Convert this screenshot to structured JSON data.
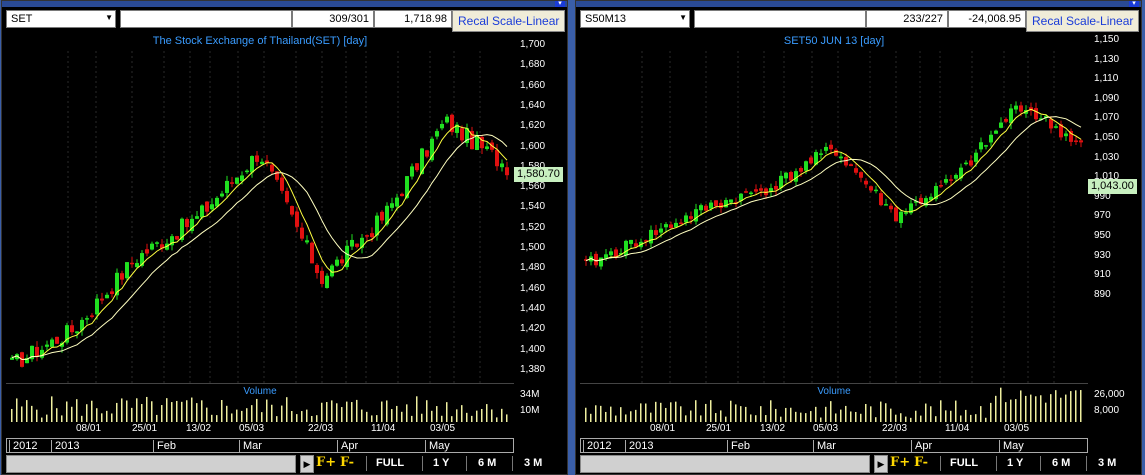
{
  "panels": [
    {
      "symbol": "SET",
      "ratio": "309/301",
      "last_value": "1,718.98",
      "recal_label": "Recal Scale-Linear",
      "chart_title": "The Stock Exchange of Thailand(SET) [day]",
      "volume_label": "Volume",
      "current_price_label": "1,580.70",
      "y_ticks": [
        "1,700",
        "1,680",
        "1,660",
        "1,640",
        "1,620",
        "1,600",
        "1,580",
        "1,560",
        "1,540",
        "1,520",
        "1,500",
        "1,480",
        "1,460",
        "1,440",
        "1,420",
        "1,400",
        "1,380"
      ],
      "volume_ticks": [
        "34M",
        "10M"
      ],
      "date_ticks": [
        "08/01",
        "25/01",
        "13/02",
        "05/03",
        "22/03",
        "11/04",
        "03/05"
      ],
      "month_ticks": [
        "2012",
        "2013",
        "Feb",
        "Mar",
        "Apr",
        "May"
      ],
      "bottom": {
        "full": "FULL",
        "y1": "1 Y",
        "m6": "6 M",
        "m3": "3 M",
        "fplus": "F+",
        "fminus": "F-"
      }
    },
    {
      "symbol": "S50M13",
      "ratio": "233/227",
      "last_value": "-24,008.95",
      "recal_label": "Recal Scale-Linear",
      "chart_title": "SET50 JUN 13  [day]",
      "volume_label": "Volume",
      "current_price_label": "1,043.00",
      "y_ticks": [
        "1,150",
        "1,130",
        "1,110",
        "1,090",
        "1,070",
        "1,050",
        "1,030",
        "1,010",
        "990",
        "970",
        "950",
        "930",
        "910",
        "890"
      ],
      "volume_ticks": [
        "26,000",
        "8,000"
      ],
      "date_ticks": [
        "08/01",
        "25/01",
        "13/02",
        "05/03",
        "22/03",
        "11/04",
        "03/05"
      ],
      "month_ticks": [
        "2012",
        "2013",
        "Feb",
        "Mar",
        "Apr",
        "May"
      ],
      "bottom": {
        "full": "FULL",
        "y1": "1 Y",
        "m6": "6 M",
        "m3": "3 M",
        "fplus": "F+",
        "fminus": "F-"
      }
    }
  ],
  "colors": {
    "up": "#20e020",
    "down": "#e01010",
    "ma_fast": "#ffff40",
    "ma_slow": "#ffffc0",
    "volume": "#f0f0a0",
    "title": "#3a9cff",
    "grid": "#333333"
  },
  "chart_data": [
    {
      "type": "candlestick",
      "title": "The Stock Exchange of Thailand(SET) [day]",
      "ylim": [
        1370,
        1710
      ],
      "x": [
        "2012-12-27",
        "2013-01-08",
        "2013-01-25",
        "2013-02-13",
        "2013-03-05",
        "2013-03-22",
        "2013-04-11",
        "2013-05-03",
        "2013-05-17"
      ],
      "close_approx": [
        1385,
        1420,
        1490,
        1530,
        1595,
        1470,
        1530,
        1625,
        1580.7
      ],
      "current_price": 1580.7
    },
    {
      "type": "candlestick",
      "title": "SET50 JUN 13  [day]",
      "ylim": [
        885,
        1155
      ],
      "x": [
        "2012-12-27",
        "2013-01-08",
        "2013-01-25",
        "2013-02-13",
        "2013-03-05",
        "2013-03-22",
        "2013-04-11",
        "2013-05-03",
        "2013-05-17"
      ],
      "close_approx": [
        920,
        950,
        980,
        1000,
        1040,
        970,
        1010,
        1085,
        1043
      ],
      "current_price": 1043.0
    }
  ]
}
